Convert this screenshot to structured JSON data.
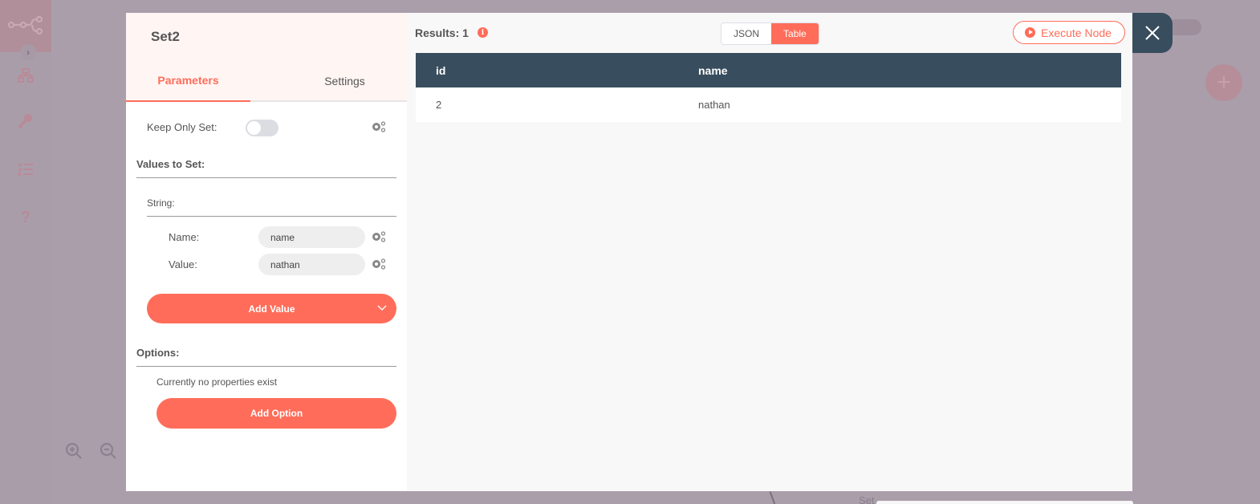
{
  "background": {
    "sidebar_icons": [
      "workflow-icon",
      "key-icon",
      "list-icon",
      "help-icon"
    ],
    "help_glyph": "?",
    "plus_glyph": "+",
    "expand_glyph": "›",
    "node_label": "Set"
  },
  "modal": {
    "node_name": "Set2",
    "tabs": [
      {
        "label": "Parameters",
        "active": true
      },
      {
        "label": "Settings",
        "active": false
      }
    ],
    "keep_only_set": {
      "label": "Keep Only Set:",
      "value": false
    },
    "values_to_set": {
      "title": "Values to Set:",
      "group_label": "String:",
      "fields": [
        {
          "label": "Name:",
          "value": "name"
        },
        {
          "label": "Value:",
          "value": "nathan"
        }
      ],
      "add_button": "Add Value"
    },
    "options": {
      "title": "Options:",
      "empty_text": "Currently no properties exist",
      "add_button": "Add Option"
    },
    "output": {
      "results_label": "Results: 1",
      "view_modes": [
        "JSON",
        "Table"
      ],
      "active_view": "Table",
      "execute_button": "Execute Node",
      "table": {
        "columns": [
          "id",
          "name"
        ],
        "rows": [
          [
            "2",
            "nathan"
          ]
        ]
      }
    },
    "close_glyph": "✕"
  },
  "colors": {
    "accent": "#ff6d5a",
    "header_dark": "#384d5d",
    "overlay": "#aa9eab"
  }
}
